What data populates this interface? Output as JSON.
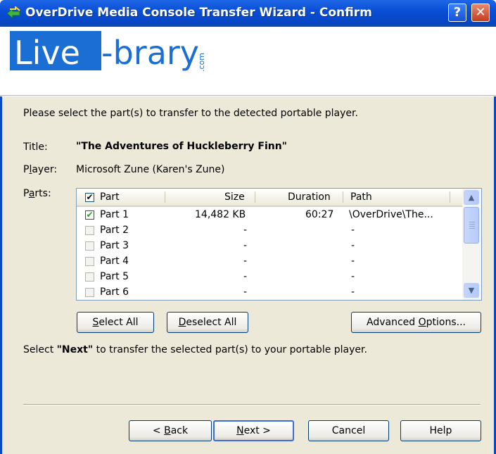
{
  "window": {
    "title": "OverDrive Media Console Transfer Wizard - Confirm",
    "help_glyph": "?",
    "close_glyph": "✕"
  },
  "logo": {
    "main": "Live",
    "dash": "-brary",
    "suffix": ".com",
    "colors": {
      "blue": "#1b6ed3",
      "white": "#ffffff"
    }
  },
  "instructions": "Please select the part(s) to transfer to the detected portable player.",
  "fields": {
    "title_label": "Title:",
    "title_value": "\"The Adventures of Huckleberry Finn\"",
    "player_label": "Player:",
    "player_value": "Microsoft Zune (Karen's Zune)",
    "parts_label": "Parts:"
  },
  "table": {
    "headers": {
      "part": "Part",
      "size": "Size",
      "duration": "Duration",
      "path": "Path"
    },
    "header_checked": true,
    "rows": [
      {
        "checked": true,
        "part": "Part 1",
        "size": "14,482 KB",
        "duration": "60:27",
        "path": "\\OverDrive\\The..."
      },
      {
        "checked": false,
        "part": "Part 2",
        "size": "-",
        "duration": "",
        "path": "-"
      },
      {
        "checked": false,
        "part": "Part 3",
        "size": "-",
        "duration": "",
        "path": "-"
      },
      {
        "checked": false,
        "part": "Part 4",
        "size": "-",
        "duration": "",
        "path": "-"
      },
      {
        "checked": false,
        "part": "Part 5",
        "size": "-",
        "duration": "",
        "path": "-"
      },
      {
        "checked": false,
        "part": "Part 6",
        "size": "-",
        "duration": "",
        "path": "-"
      }
    ]
  },
  "buttons": {
    "select_all": {
      "pre": "",
      "key": "S",
      "post": "elect All"
    },
    "deselect_all": {
      "pre": "",
      "key": "D",
      "post": "eselect All"
    },
    "advanced": {
      "pre": "Advanced ",
      "key": "O",
      "post": "ptions..."
    },
    "back": {
      "pre": "< ",
      "key": "B",
      "post": "ack"
    },
    "next": {
      "pre": "",
      "key": "N",
      "post": "ext >"
    },
    "cancel": "Cancel",
    "help": "Help"
  },
  "footer_text": {
    "pre": "Select ",
    "bold": "\"Next\"",
    "post": " to transfer the selected part(s) to your portable player."
  },
  "colors": {
    "titlebar": "#0a4fd6",
    "dialog_bg": "#ece9d8",
    "check_green": "#21a121"
  }
}
